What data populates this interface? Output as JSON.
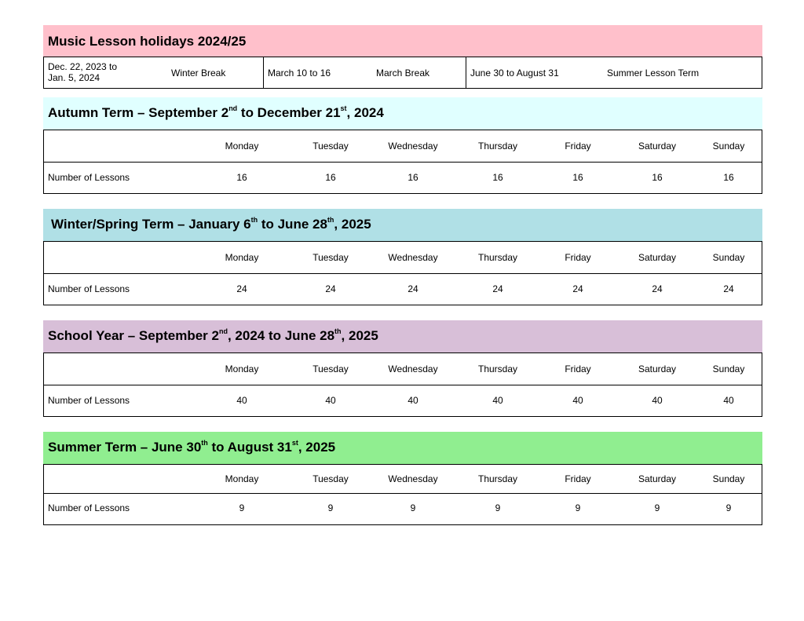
{
  "holidays": {
    "title": "Music Lesson holidays 2024/25",
    "winter_dates_line1": "Dec. 22, 2023 to",
    "winter_dates_line2": "Jan. 5, 2024",
    "winter_name": "Winter Break",
    "march_dates": "March 10 to 16",
    "march_name": "March Break",
    "summer_dates": "June 30 to August 31",
    "summer_name": "Summer Lesson Term"
  },
  "days": [
    "Monday",
    "Tuesday",
    "Wednesday",
    "Thursday",
    "Friday",
    "Saturday",
    "Sunday"
  ],
  "row_label": "Number of Lessons",
  "terms": [
    {
      "title_a": "Autumn Term – September 2",
      "sup_a": "nd",
      "title_b": " to December 21",
      "sup_b": "st",
      "title_c": ", 2024",
      "color": "#e0ffff",
      "lessons": [
        "16",
        "16",
        "16",
        "16",
        "16",
        "16",
        "16"
      ]
    },
    {
      "title_a": "Winter/Spring Term – January 6",
      "sup_a": "th",
      "title_b": " to June 28",
      "sup_b": "th",
      "title_c": ", 2025",
      "color": "#b0e0e6",
      "lessons": [
        "24",
        "24",
        "24",
        "24",
        "24",
        "24",
        "24"
      ]
    },
    {
      "title_a": "School Year – September 2",
      "sup_a": "nd",
      "title_b": ", 2024 to June 28",
      "sup_b": "th",
      "title_c": ", 2025",
      "color": "#d8bfd8",
      "lessons": [
        "40",
        "40",
        "40",
        "40",
        "40",
        "40",
        "40"
      ]
    },
    {
      "title_a": "Summer Term – June 30",
      "sup_a": "th",
      "title_b": " to August 31",
      "sup_b": "st",
      "title_c": ", 2025",
      "color": "#90ee90",
      "lessons": [
        "9",
        "9",
        "9",
        "9",
        "9",
        "9",
        "9"
      ]
    }
  ]
}
